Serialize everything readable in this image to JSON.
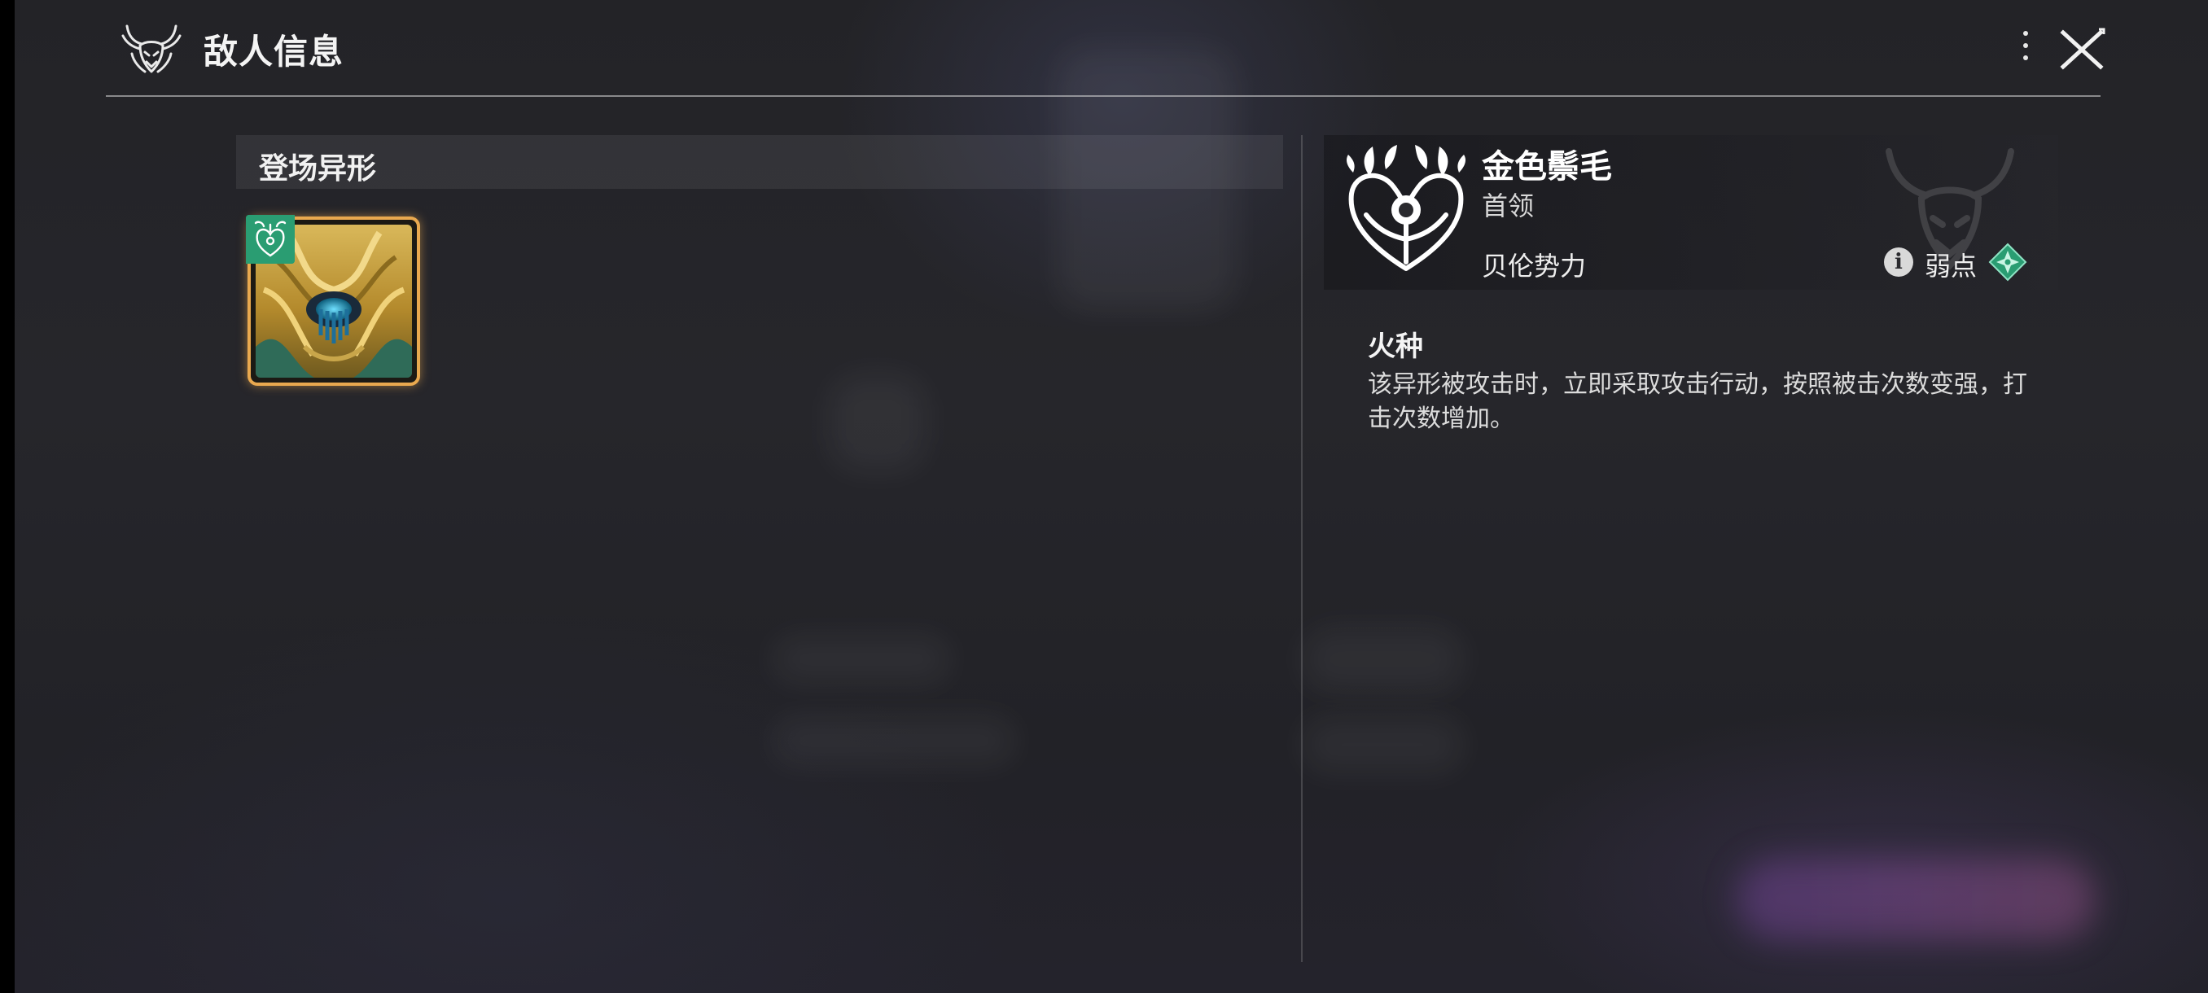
{
  "header": {
    "title": "敌人信息",
    "logo_icon": "horned-demon-emblem-icon",
    "more_icon": "more-vertical-icon",
    "close_icon": "close-icon"
  },
  "left_panel": {
    "section_title": "登场异形",
    "enemies": [
      {
        "portrait_icon": "golden-mane-portrait",
        "faction_badge_icon": "belen-faction-badge-icon",
        "selected": true
      }
    ]
  },
  "detail": {
    "name": "金色鬃毛",
    "rank": "首领",
    "faction": "贝伦势力",
    "faction_emblem_icon": "belen-faction-emblem-icon",
    "weakness_label": "弱点",
    "weakness_element_icon": "wind-element-icon",
    "info_icon": "info-icon",
    "skill": {
      "name": "火种",
      "description": "该异形被攻击时，立即采取攻击行动，按照被击次数变强，打击次数增加。"
    }
  },
  "colors": {
    "accent_orange": "#e9a94f",
    "faction_green": "#2a9d72",
    "background": "#242428"
  }
}
